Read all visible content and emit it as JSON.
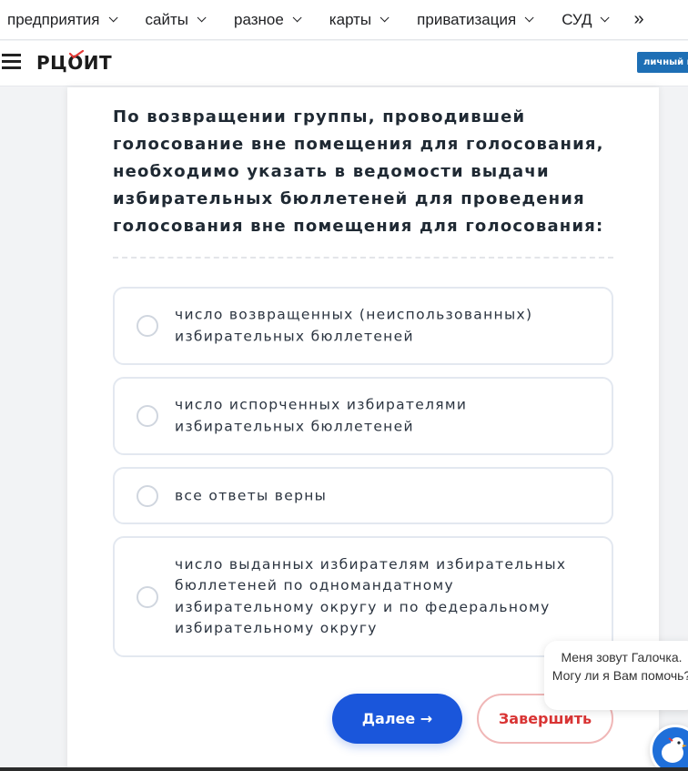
{
  "topnav": {
    "items": [
      {
        "label": "предприятия"
      },
      {
        "label": "сайты"
      },
      {
        "label": "разное"
      },
      {
        "label": "карты"
      },
      {
        "label": "приватизация"
      },
      {
        "label": "СУД"
      }
    ],
    "more_label": "»"
  },
  "header": {
    "logo_text": "РЦОИТ",
    "account_button": "личный кабинет"
  },
  "quiz": {
    "question": "По возвращении группы, проводившей голосование вне помещения для голосования, необходимо указать в ведомости выдачи избирательных бюллетеней для проведения голосования вне помещения для голосования:",
    "options": [
      {
        "text": "число возвращенных (неиспользованных) избирательных бюллетеней"
      },
      {
        "text": "число испорченных избирателями избирательных бюллетеней"
      },
      {
        "text": "все ответы верны"
      },
      {
        "text": "число выданных избирателям избирательных бюллетеней по одномандатному избирательному округу и по федеральному избирательному округу"
      }
    ],
    "next_button": "Далее →",
    "finish_button": "Завершить"
  },
  "chat": {
    "message": "Меня зовут Галочка. Могу ли я Вам помочь?"
  },
  "colors": {
    "primary": "#1a56db",
    "finish": "#d93434",
    "account": "#1e6fb5"
  }
}
